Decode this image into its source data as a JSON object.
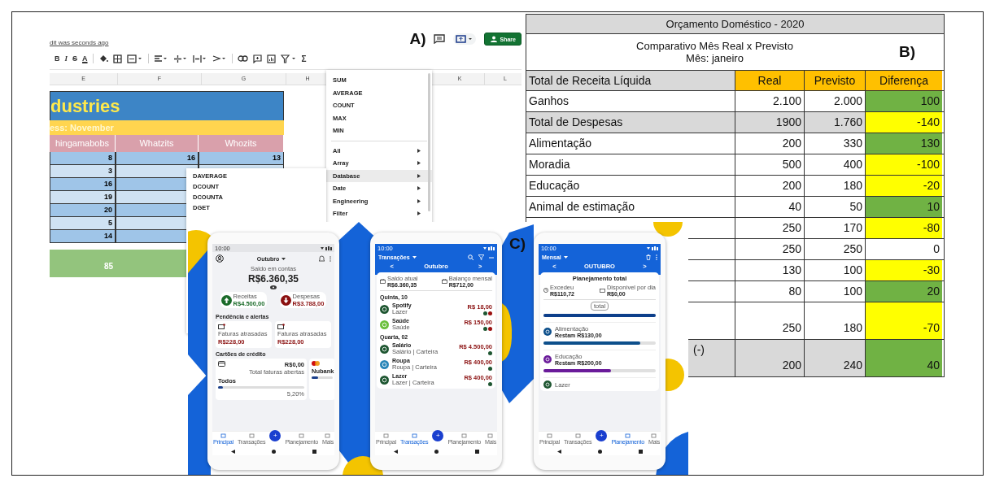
{
  "panel_a": {
    "status": "dit was seconds ago",
    "label": "A)",
    "share_button": "Share",
    "format_buttons": [
      {
        "label": "B",
        "kind": "bold"
      },
      {
        "label": "I",
        "kind": "italic"
      },
      {
        "label": "S",
        "kind": "strike"
      },
      {
        "label": "A",
        "kind": "color"
      }
    ],
    "sum_button": "Σ",
    "column_headers": [
      "E",
      "F",
      "G",
      "H",
      "K",
      "L"
    ],
    "sheet": {
      "title": "dustries",
      "subtitle": "ess: November",
      "headers": [
        "hingamabobs",
        "Whatzits",
        "Whozits"
      ],
      "rows": [
        {
          "e": "8",
          "f": "16",
          "g": "13"
        },
        {
          "e": "3"
        },
        {
          "e": "16"
        },
        {
          "e": "19"
        },
        {
          "e": "20"
        },
        {
          "e": "5"
        },
        {
          "e": "14"
        }
      ],
      "total": "85"
    },
    "function_menu": [
      {
        "label": "SUM",
        "kind": "function",
        "selected": false
      },
      {
        "label": "AVERAGE",
        "kind": "function",
        "selected": false
      },
      {
        "label": "COUNT",
        "kind": "function",
        "selected": false
      },
      {
        "label": "MAX",
        "kind": "function",
        "selected": false
      },
      {
        "label": "MIN",
        "kind": "function",
        "selected": false
      },
      {
        "label": "All",
        "kind": "category",
        "selected": false
      },
      {
        "label": "Array",
        "kind": "category",
        "selected": false
      },
      {
        "label": "Database",
        "kind": "category",
        "selected": true
      },
      {
        "label": "Date",
        "kind": "category",
        "selected": false
      },
      {
        "label": "Engineering",
        "kind": "category",
        "selected": false
      },
      {
        "label": "Filter",
        "kind": "category",
        "selected": false
      }
    ],
    "submenu": [
      "DAVERAGE",
      "DCOUNT",
      "DCOUNTA",
      "DGET"
    ]
  },
  "panel_b": {
    "title": "Orçamento Doméstico - 2020",
    "subtitle": "Comparativo Mês Real x Previsto",
    "month": "Mês: janeiro",
    "label": "B)",
    "columns": [
      "Total de Receita Líquida",
      "Real",
      "Previsto",
      "Diferença"
    ],
    "rows": [
      {
        "label": "Ganhos",
        "real": "2.100",
        "previsto": "2.000",
        "diferenca": "100",
        "color": "#70b244",
        "shaded": false
      },
      {
        "label": "Total de Despesas",
        "real": "1900",
        "previsto": "1.760",
        "diferenca": "-140",
        "color": "#ffff00",
        "shaded": true
      },
      {
        "label": "Alimentação",
        "real": "200",
        "previsto": "330",
        "diferenca": "130",
        "color": "#70b244",
        "shaded": false
      },
      {
        "label": "Moradia",
        "real": "500",
        "previsto": "400",
        "diferenca": "-100",
        "color": "#ffff00",
        "shaded": false
      },
      {
        "label": "Educação",
        "real": "200",
        "previsto": "180",
        "diferenca": "-20",
        "color": "#ffff00",
        "shaded": false
      },
      {
        "label": "Animal de estimação",
        "real": "40",
        "previsto": "50",
        "diferenca": "10",
        "color": "#70b244",
        "shaded": false
      },
      {
        "real": "250",
        "previsto": "170",
        "diferenca": "-80",
        "color": "#ffff00",
        "shaded": false
      },
      {
        "real": "250",
        "previsto": "250",
        "diferenca": "0",
        "color": "#ffffff",
        "shaded": false
      },
      {
        "real": "130",
        "previsto": "100",
        "diferenca": "-30",
        "color": "#ffff00",
        "shaded": false
      },
      {
        "real": "80",
        "previsto": "100",
        "diferenca": "20",
        "color": "#70b244",
        "shaded": false
      },
      {
        "real": "250",
        "previsto": "180",
        "diferenca": "-70",
        "color": "#ffff00",
        "shaded": false
      },
      {
        "label": "(-)",
        "real": "200",
        "previsto": "240",
        "diferenca": "40",
        "color": "#70b244",
        "shaded": true
      }
    ]
  },
  "panel_c": {
    "label": "C)",
    "home": {
      "time": "10:00",
      "month": "Outubro",
      "balance_label": "Saldo em contas",
      "balance": "R$6.360,35",
      "income": {
        "label": "Receitas",
        "value": "R$4.500,00"
      },
      "expense": {
        "label": "Despesas",
        "value": "R$3.788,00"
      },
      "alerts_title": "Pendência e alertas",
      "alerts": [
        {
          "label": "Faturas atrasadas",
          "value": "R$228,00"
        },
        {
          "label": "Faturas atrasadas",
          "value": "R$228,00"
        }
      ],
      "cards_title": "Cartões de crédito",
      "card": {
        "name": "Todos",
        "amount": "R$0,00",
        "amount_label": "Total faturas abertas",
        "percent": "5,20%",
        "level": 0.06
      },
      "second_card": {
        "name": "Nubank",
        "level": 0.3
      },
      "fab": "+",
      "nav": [
        {
          "label": "Principal",
          "selected": true
        },
        {
          "label": "Transações",
          "selected": false
        },
        {
          "label": "Planejamento",
          "selected": false
        },
        {
          "label": "Mais",
          "selected": false
        }
      ]
    },
    "transactions": {
      "time": "10:00",
      "title": "Transações",
      "prev": "<",
      "month": "Outubro",
      "next": ">",
      "summary": [
        {
          "label": "Saldo atual",
          "value": "R$6.360,35"
        },
        {
          "label": "Balanço mensal",
          "value": "R$712,00"
        }
      ],
      "groups": [
        {
          "day": "Quinta, 10",
          "items": [
            {
              "name": "Spotify",
              "category": "Lazer",
              "amount": "R$ 18,00",
              "color": "#1e5631",
              "dots": [
                {
                  "color": "#1e5631"
                },
                {
                  "color": "#9b1010"
                }
              ]
            },
            {
              "name": "Saúde",
              "category": "Saúde",
              "amount": "R$ 150,00",
              "color": "#6abf3c",
              "dots": [
                {
                  "color": "#1e5631"
                },
                {
                  "color": "#9b1010"
                }
              ]
            }
          ]
        },
        {
          "day": "Quarta, 02",
          "items": [
            {
              "name": "Salário",
              "category": "Salário | Carteira",
              "amount": "R$ 4.500,00",
              "color": "#1e5631",
              "dots": [
                {
                  "color": "#1e5631"
                }
              ]
            },
            {
              "name": "Roupa",
              "category": "Roupa | Carteira",
              "amount": "R$ 400,00",
              "color": "#2a86b8",
              "dots": [
                {
                  "color": "#1e5631"
                }
              ]
            },
            {
              "name": "Lazer",
              "category": "Lazer | Carteira",
              "amount": "R$ 400,00",
              "color": "#1e5631",
              "dots": [
                {
                  "color": "#1e5631"
                }
              ]
            }
          ]
        }
      ],
      "fab": "+",
      "nav": [
        {
          "label": "Principal",
          "selected": false
        },
        {
          "label": "Transações",
          "selected": true
        },
        {
          "label": "Planejamento",
          "selected": false
        },
        {
          "label": "Mais",
          "selected": false
        }
      ]
    },
    "planning": {
      "time": "10:00",
      "title": "Mensal",
      "prev": "<",
      "month": "OUTUBRO",
      "next": ">",
      "heading": "Planejamento total",
      "exceeded": {
        "label": "Excedeu",
        "value": "R$110,72"
      },
      "daily": {
        "label": "Disponível por dia",
        "value": "R$0,00"
      },
      "pill": "total",
      "total_bar": {
        "level": 1
      },
      "categories": [
        {
          "name": "Alimentação",
          "remaining": "Restam R$130,00",
          "level": 0.86,
          "color": "#0d4f8b"
        },
        {
          "name": "Educação",
          "remaining": "Restam R$200,00",
          "level": 0.6,
          "color": "#6a1b9a"
        },
        {
          "name": "Lazer",
          "color": "#1e5631"
        }
      ],
      "fab": "+",
      "nav": [
        {
          "label": "Principal",
          "selected": false
        },
        {
          "label": "Transações",
          "selected": false
        },
        {
          "label": "Planejamento",
          "selected": true
        },
        {
          "label": "Mais",
          "selected": false
        }
      ]
    }
  }
}
